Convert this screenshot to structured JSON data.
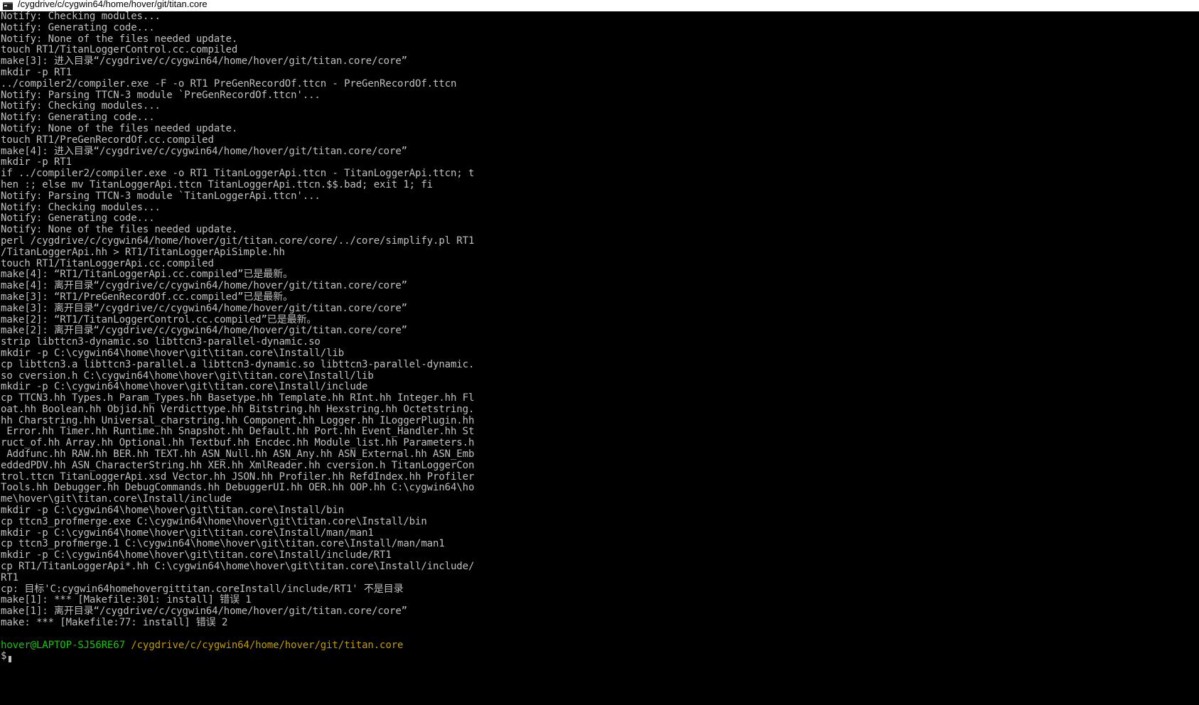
{
  "window": {
    "title": "/cygdrive/c/cygwin64/home/hover/git/titan.core"
  },
  "terminal": {
    "lines": [
      "Notify: Checking modules...",
      "Notify: Generating code...",
      "Notify: None of the files needed update.",
      "touch RT1/TitanLoggerControl.cc.compiled",
      "make[3]: 进入目录“/cygdrive/c/cygwin64/home/hover/git/titan.core/core”",
      "mkdir -p RT1",
      "../compiler2/compiler.exe -F -o RT1 PreGenRecordOf.ttcn - PreGenRecordOf.ttcn",
      "Notify: Parsing TTCN-3 module `PreGenRecordOf.ttcn'...",
      "Notify: Checking modules...",
      "Notify: Generating code...",
      "Notify: None of the files needed update.",
      "touch RT1/PreGenRecordOf.cc.compiled",
      "make[4]: 进入目录“/cygdrive/c/cygwin64/home/hover/git/titan.core/core”",
      "mkdir -p RT1",
      "if ../compiler2/compiler.exe -o RT1 TitanLoggerApi.ttcn - TitanLoggerApi.ttcn; t",
      "hen :; else mv TitanLoggerApi.ttcn TitanLoggerApi.ttcn.$$.bad; exit 1; fi",
      "Notify: Parsing TTCN-3 module `TitanLoggerApi.ttcn'...",
      "Notify: Checking modules...",
      "Notify: Generating code...",
      "Notify: None of the files needed update.",
      "perl /cygdrive/c/cygwin64/home/hover/git/titan.core/core/../core/simplify.pl RT1",
      "/TitanLoggerApi.hh > RT1/TitanLoggerApiSimple.hh",
      "touch RT1/TitanLoggerApi.cc.compiled",
      "make[4]: “RT1/TitanLoggerApi.cc.compiled”已是最新。",
      "make[4]: 离开目录“/cygdrive/c/cygwin64/home/hover/git/titan.core/core”",
      "make[3]: “RT1/PreGenRecordOf.cc.compiled”已是最新。",
      "make[3]: 离开目录“/cygdrive/c/cygwin64/home/hover/git/titan.core/core”",
      "make[2]: “RT1/TitanLoggerControl.cc.compiled”已是最新。",
      "make[2]: 离开目录“/cygdrive/c/cygwin64/home/hover/git/titan.core/core”",
      "strip libttcn3-dynamic.so libttcn3-parallel-dynamic.so",
      "mkdir -p C:\\cygwin64\\home\\hover\\git\\titan.core\\Install/lib",
      "cp libttcn3.a libttcn3-parallel.a libttcn3-dynamic.so libttcn3-parallel-dynamic.",
      "so cversion.h C:\\cygwin64\\home\\hover\\git\\titan.core\\Install/lib",
      "mkdir -p C:\\cygwin64\\home\\hover\\git\\titan.core\\Install/include",
      "cp TTCN3.hh Types.h Param_Types.hh Basetype.hh Template.hh RInt.hh Integer.hh Fl",
      "oat.hh Boolean.hh Objid.hh Verdicttype.hh Bitstring.hh Hexstring.hh Octetstring.",
      "hh Charstring.hh Universal_charstring.hh Component.hh Logger.hh ILoggerPlugin.hh",
      " Error.hh Timer.hh Runtime.hh Snapshot.hh Default.hh Port.hh Event_Handler.hh St",
      "ruct_of.hh Array.hh Optional.hh Textbuf.hh Encdec.hh Module_list.hh Parameters.h",
      " Addfunc.hh RAW.hh BER.hh TEXT.hh ASN_Null.hh ASN_Any.hh ASN_External.hh ASN_Emb",
      "eddedPDV.hh ASN_CharacterString.hh XER.hh XmlReader.hh cversion.h TitanLoggerCon",
      "trol.ttcn TitanLoggerApi.xsd Vector.hh JSON.hh Profiler.hh RefdIndex.hh Profiler",
      "Tools.hh Debugger.hh DebugCommands.hh DebuggerUI.hh OER.hh OOP.hh C:\\cygwin64\\ho",
      "me\\hover\\git\\titan.core\\Install/include",
      "mkdir -p C:\\cygwin64\\home\\hover\\git\\titan.core\\Install/bin",
      "cp ttcn3_profmerge.exe C:\\cygwin64\\home\\hover\\git\\titan.core\\Install/bin",
      "mkdir -p C:\\cygwin64\\home\\hover\\git\\titan.core\\Install/man/man1",
      "cp ttcn3_profmerge.1 C:\\cygwin64\\home\\hover\\git\\titan.core\\Install/man/man1",
      "mkdir -p C:\\cygwin64\\home\\hover\\git\\titan.core\\Install/include/RT1",
      "cp RT1/TitanLoggerApi*.hh C:\\cygwin64\\home\\hover\\git\\titan.core\\Install/include/",
      "RT1",
      "cp: 目标'C:cygwin64homehovergittitan.coreInstall/include/RT1' 不是目录",
      "make[1]: *** [Makefile:301: install] 错误 1",
      "make[1]: 离开目录“/cygdrive/c/cygwin64/home/hover/git/titan.core/core”",
      "make: *** [Makefile:77: install] 错误 2",
      ""
    ],
    "prompt": {
      "user_host": "hover@LAPTOP-SJ56RE67",
      "path": "/cygdrive/c/cygwin64/home/hover/git/titan.core",
      "symbol": "$"
    }
  },
  "colors": {
    "background": "#000000",
    "foreground": "#c0c0c0",
    "prompt_user": "#16c60c",
    "prompt_path": "#c19c00",
    "titlebar": "#ffffff"
  }
}
